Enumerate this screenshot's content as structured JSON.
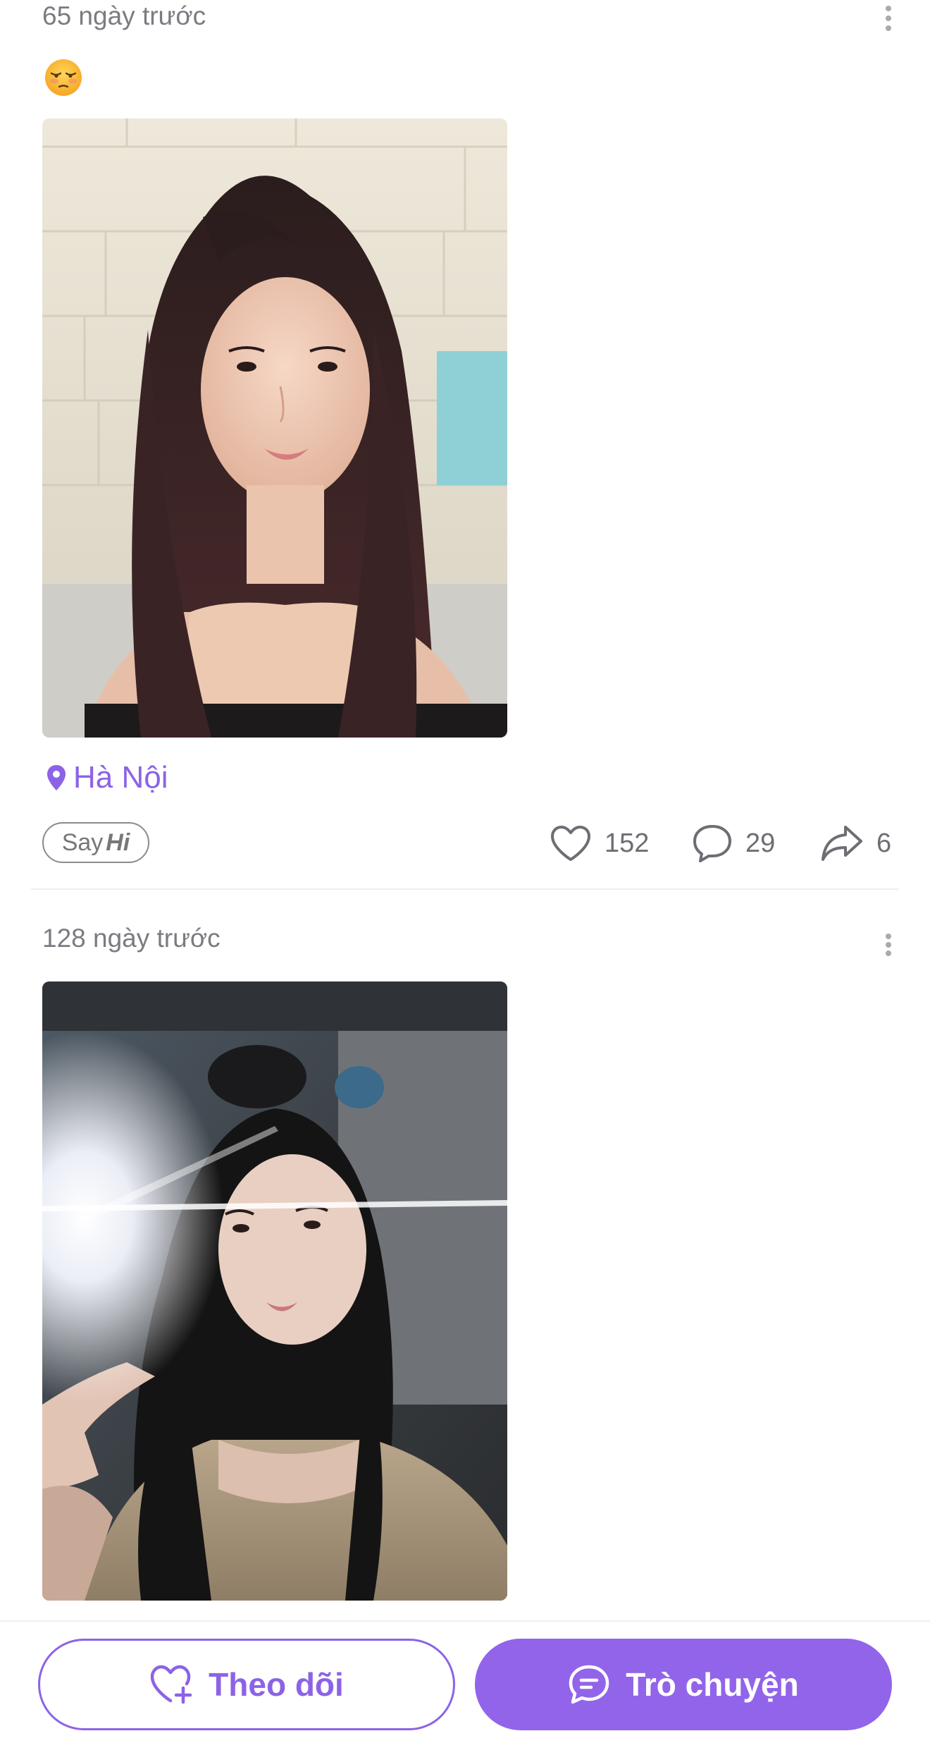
{
  "posts": [
    {
      "time": "65 ngày trước",
      "emoji_icon": "flushed-face-icon",
      "location": "Hà Nội",
      "say": "Say",
      "hi": "Hi",
      "likes": "152",
      "comments": "29",
      "shares": "6"
    },
    {
      "time": "128 ngày trước"
    }
  ],
  "bottom_bar": {
    "follow_label": "Theo dõi",
    "chat_label": "Trò chuyện"
  },
  "colors": {
    "accent": "#8c63e6",
    "accent_fill": "#9264ea",
    "muted_text": "#7b7b82"
  }
}
